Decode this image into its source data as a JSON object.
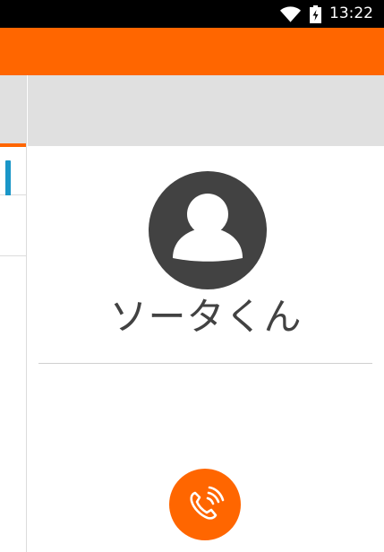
{
  "status_bar": {
    "time": "13:22",
    "icons": [
      "wifi-icon",
      "battery-charging-icon"
    ]
  },
  "contact": {
    "name": "ソータくん",
    "avatar_icon": "person-icon"
  },
  "actions": {
    "call_icon": "phone-ringing-icon"
  },
  "colors": {
    "accent": "#ff6600",
    "status_bar": "#000000",
    "header_gray": "#e0e0e0",
    "avatar_bg": "#424242",
    "selection_blue": "#1a96c8"
  }
}
